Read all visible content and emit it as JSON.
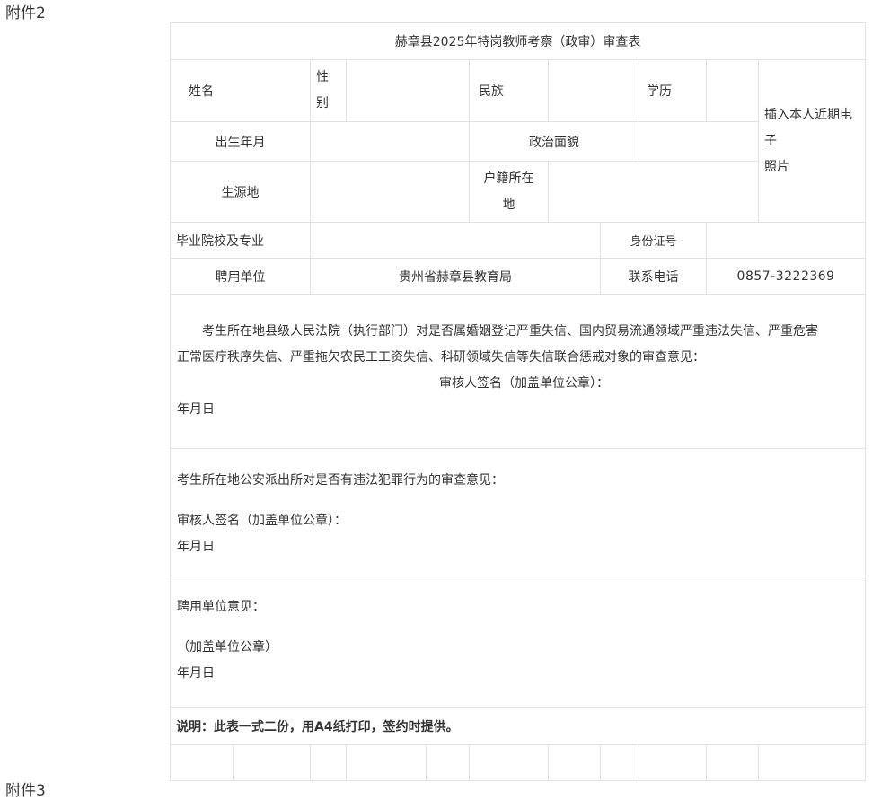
{
  "attachment_top": "附件2",
  "attachment_bottom": "附件3",
  "form": {
    "title": "赫章县2025年特岗教师考察（政审）审查表",
    "labels": {
      "name": "姓名",
      "gender_1": "性",
      "gender_2": "别",
      "ethnicity": "民族",
      "education": "学历",
      "photo_1": "插入本人近期电子",
      "photo_2": "照片",
      "birth": "出生年月",
      "political": "政治面貌",
      "origin": "生源地",
      "household_1": "户籍所在",
      "household_2": "地",
      "school_major": "毕业院校及专业",
      "id_number": "身份证号",
      "employer": "聘用单位",
      "phone": "联系电话"
    },
    "values": {
      "employer": "贵州省赫章县教育局",
      "phone": "0857-3222369"
    },
    "court_section": {
      "text_line1": "考生所在地县级人民法院（执行部门）对是否属婚姻登记严重失信、国内贸易流通领域严重违法失信、严重危害",
      "text_line2": "正常医疗秩序失信、严重拖欠农民工工资失信、科研领域失信等失信联合惩戒对象的审查意见：",
      "signature": "审核人签名（加盖单位公章）：",
      "date": "年月日"
    },
    "police_section": {
      "text": "考生所在地公安派出所对是否有违法犯罪行为的审查意见：",
      "signature": "审核人签名（加盖单位公章）：",
      "date": "年月日"
    },
    "employer_section": {
      "text": "聘用单位意见：",
      "stamp": "（加盖单位公章）",
      "date": "年月日"
    },
    "note": "说明：此表一式二份，用A4纸打印，签约时提供。"
  }
}
